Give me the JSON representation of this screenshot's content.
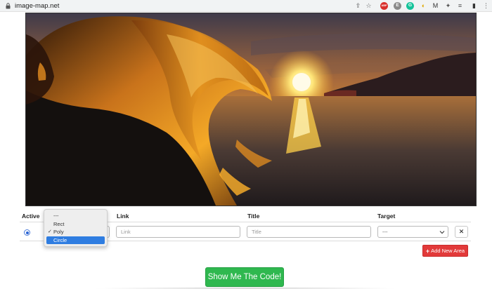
{
  "browser": {
    "url": "image-map.net",
    "extensions": [
      {
        "name": "share-icon",
        "glyph": "⇪",
        "color": "#555555"
      },
      {
        "name": "star-icon",
        "glyph": "☆",
        "color": "#555555"
      },
      {
        "name": "adblock-icon",
        "glyph": "ABP",
        "color": "#d9302c"
      },
      {
        "name": "extension-e-icon",
        "glyph": "E",
        "color": "#8a8a8a"
      },
      {
        "name": "grammarly-icon",
        "glyph": "G",
        "color": "#15c39a"
      },
      {
        "name": "honey-icon",
        "glyph": "◐",
        "color": "#e0a800"
      },
      {
        "name": "gmail-m-icon",
        "glyph": "M",
        "color": "#333333"
      },
      {
        "name": "puzzle-icon",
        "glyph": "✦",
        "color": "#555555"
      },
      {
        "name": "reading-list-icon",
        "glyph": "≡",
        "color": "#555555"
      },
      {
        "name": "sidebar-icon",
        "glyph": "▮",
        "color": "#333333"
      },
      {
        "name": "more-icon",
        "glyph": "⋮",
        "color": "#555555"
      }
    ]
  },
  "table": {
    "headers": {
      "active": "Active",
      "link": "Link",
      "title": "Title",
      "target": "Target"
    },
    "row": {
      "link_placeholder": "Link",
      "title_placeholder": "Title",
      "target_value": "---",
      "delete_label": "✕"
    }
  },
  "shape_dropdown": {
    "options": [
      {
        "label": "---",
        "checked": false,
        "highlighted": false
      },
      {
        "label": "Rect",
        "checked": false,
        "highlighted": false
      },
      {
        "label": "Poly",
        "checked": true,
        "highlighted": false
      },
      {
        "label": "Circle",
        "checked": false,
        "highlighted": true
      }
    ]
  },
  "buttons": {
    "add_new_area": "Add New Area",
    "add_icon": "+",
    "show_code": "Show Me The Code!"
  },
  "colors": {
    "add_button": "#e23a3a",
    "show_button": "#2fb84f",
    "selection": "#2f7de1"
  }
}
